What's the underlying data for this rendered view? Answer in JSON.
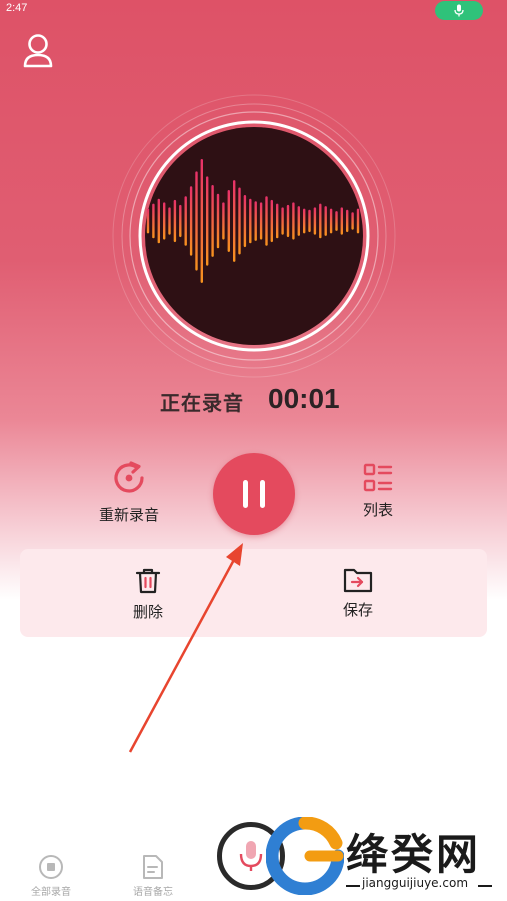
{
  "status_bar": {
    "time": "2:47",
    "mic_indicator_icon": "mic-icon"
  },
  "header": {
    "profile_icon": "user-icon"
  },
  "recorder": {
    "status_label": "正在录音",
    "timer": "00:01",
    "waveform_levels": [
      0.2,
      0.28,
      0.36,
      0.3,
      0.22,
      0.34,
      0.26,
      0.4,
      0.56,
      0.8,
      1.0,
      0.72,
      0.58,
      0.44,
      0.3,
      0.5,
      0.66,
      0.54,
      0.42,
      0.36,
      0.32,
      0.3,
      0.4,
      0.34,
      0.28,
      0.22,
      0.26,
      0.3,
      0.24,
      0.2,
      0.18,
      0.22,
      0.28,
      0.24,
      0.2,
      0.16,
      0.22,
      0.18,
      0.14,
      0.2
    ],
    "colors": {
      "accent": "#e44a5e",
      "disc": "#2e1014",
      "wave_top": "#e8306a",
      "wave_bottom": "#f7931e"
    }
  },
  "controls": {
    "rerecord_label": "重新录音",
    "list_label": "列表",
    "delete_label": "删除",
    "save_label": "保存"
  },
  "bottom_nav": {
    "all_recordings_label": "全部录音",
    "voice_memo_label": "语音备忘"
  },
  "watermark": {
    "brand_text": "绛癸网",
    "url_text": "jiangguijiuye.com"
  }
}
